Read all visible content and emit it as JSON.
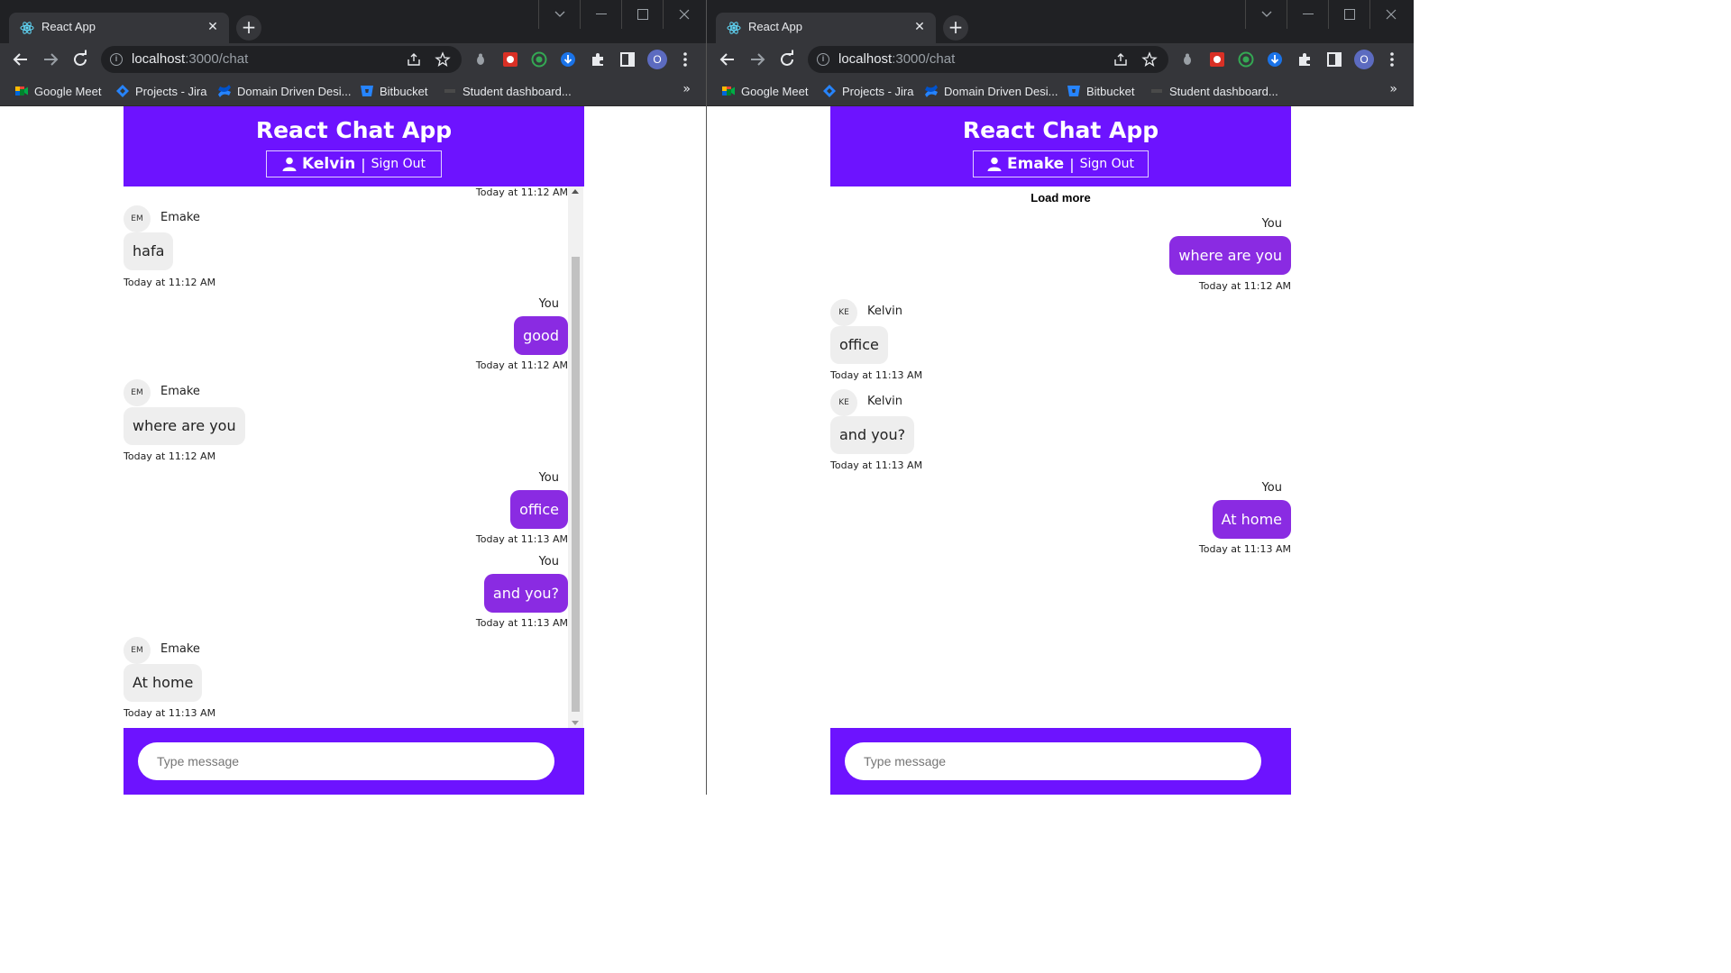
{
  "colors": {
    "accent": "#6d13ff",
    "bubble_out": "#8a2be2",
    "bubble_in": "#eeeeee",
    "chrome_dark": "#202124",
    "chrome_toolbar": "#35363a"
  },
  "browser": {
    "tab_title": "React App",
    "tab_icon": "react-icon",
    "url_host": "localhost",
    "url_path": ":3000/chat",
    "profile_initial": "O",
    "bookmarks": [
      {
        "label": "Google Meet",
        "icon": "google-meet-icon"
      },
      {
        "label": "Projects - Jira",
        "icon": "jira-icon"
      },
      {
        "label": "Domain Driven Desi...",
        "icon": "confluence-icon"
      },
      {
        "label": "Bitbucket",
        "icon": "bitbucket-icon"
      },
      {
        "label": "Student dashboard...",
        "icon": "student-icon"
      }
    ],
    "bookmarks_more": "»"
  },
  "left": {
    "app_title": "React Chat App",
    "username": "Kelvin",
    "separator": "|",
    "sign_out": "Sign Out",
    "input_placeholder": "Type message",
    "top_timestamp": "Today at 11:12 AM",
    "messages": [
      {
        "side": "in",
        "avatar": "EM",
        "sender": "Emake",
        "text": "hafa",
        "time": "Today at 11:12 AM"
      },
      {
        "side": "out",
        "sender": "You",
        "text": "good",
        "time": "Today at 11:12 AM"
      },
      {
        "side": "in",
        "avatar": "EM",
        "sender": "Emake",
        "text": "where are you",
        "time": "Today at 11:12 AM"
      },
      {
        "side": "out",
        "sender": "You",
        "text": "office",
        "time": "Today at 11:13 AM"
      },
      {
        "side": "out",
        "sender": "You",
        "text": "and you?",
        "time": "Today at 11:13 AM"
      },
      {
        "side": "in",
        "avatar": "EM",
        "sender": "Emake",
        "text": "At home",
        "time": "Today at 11:13 AM"
      }
    ]
  },
  "right": {
    "app_title": "React Chat App",
    "username": "Emake",
    "separator": "|",
    "sign_out": "Sign Out",
    "load_more": "Load more",
    "input_placeholder": "Type message",
    "messages": [
      {
        "side": "out",
        "sender": "You",
        "text": "where are you",
        "time": "Today at 11:12 AM"
      },
      {
        "side": "in",
        "avatar": "KE",
        "sender": "Kelvin",
        "text": "office",
        "time": "Today at 11:13 AM"
      },
      {
        "side": "in",
        "avatar": "KE",
        "sender": "Kelvin",
        "text": "and you?",
        "time": "Today at 11:13 AM"
      },
      {
        "side": "out",
        "sender": "You",
        "text": "At home",
        "time": "Today at 11:13 AM"
      }
    ]
  }
}
